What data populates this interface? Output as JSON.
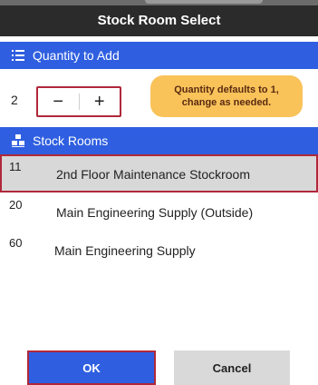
{
  "dialog": {
    "title": "Stock Room Select"
  },
  "quantity": {
    "header": "Quantity to Add",
    "header_icon": "list-icon",
    "value": "2",
    "decrement_label": "−",
    "increment_label": "+"
  },
  "callout": {
    "text": "Quantity defaults to 1, change as needed."
  },
  "rooms": {
    "header": "Stock Rooms",
    "header_icon": "stockroom-icon",
    "items": [
      {
        "code": "11",
        "name": "2nd Floor Maintenance Stockroom",
        "selected": true
      },
      {
        "code": "20",
        "name": "Main Engineering Supply (Outside)",
        "selected": false
      },
      {
        "code": "60",
        "name": "Main Engineering Supply",
        "selected": false
      }
    ]
  },
  "buttons": {
    "ok_label": "OK",
    "cancel_label": "Cancel"
  },
  "colors": {
    "section_header": "#2f5fe0",
    "title_bar": "#2b2b2b",
    "highlight_outline": "#b0283a",
    "callout_bg": "#f9c35a",
    "selected_row": "#d8d8d8"
  }
}
